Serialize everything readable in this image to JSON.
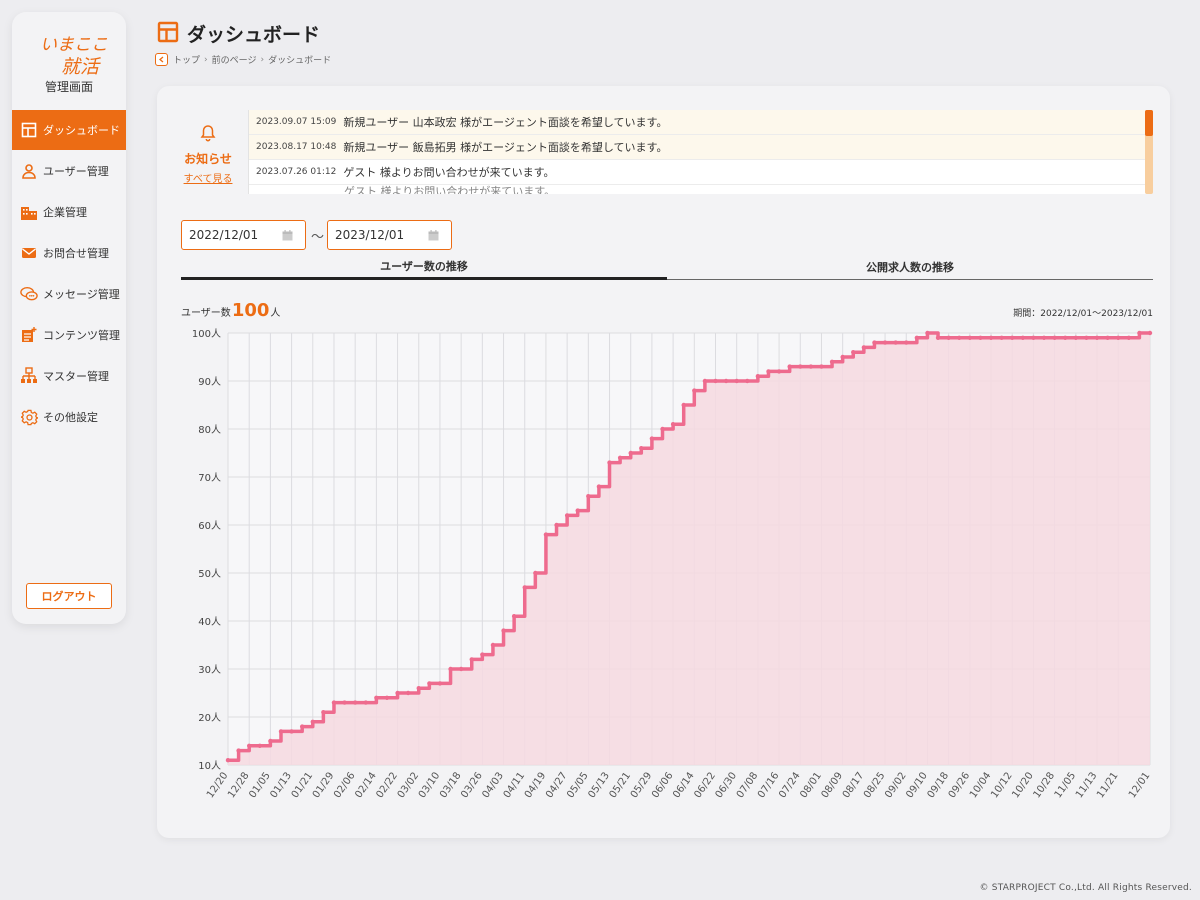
{
  "logo": {
    "line1": "いまここ",
    "line2": "就活"
  },
  "sidebar": {
    "subtitle": "管理画面",
    "items": [
      {
        "label": "ダッシュボード",
        "icon": "dashboard-icon"
      },
      {
        "label": "ユーザー管理",
        "icon": "user-icon"
      },
      {
        "label": "企業管理",
        "icon": "building-icon"
      },
      {
        "label": "お問合せ管理",
        "icon": "mail-icon"
      },
      {
        "label": "メッセージ管理",
        "icon": "chat-icon"
      },
      {
        "label": "コンテンツ管理",
        "icon": "content-edit-icon"
      },
      {
        "label": "マスター管理",
        "icon": "master-icon"
      },
      {
        "label": "その他設定",
        "icon": "gear-icon"
      }
    ],
    "logout": "ログアウト"
  },
  "header": {
    "title": "ダッシュボード",
    "breadcrumb": [
      "トップ",
      "前のページ",
      "ダッシュボード"
    ]
  },
  "notice": {
    "title": "お知らせ",
    "see_all": "すべて見る",
    "items": [
      {
        "date": "2023.09.07 15:09",
        "text": "新規ユーザー 山本政宏 様がエージェント面談を希望しています。"
      },
      {
        "date": "2023.08.17 10:48",
        "text": "新規ユーザー 飯島拓男 様がエージェント面談を希望しています。"
      },
      {
        "date": "2023.07.26 01:12",
        "text": "ゲスト 様よりお問い合わせが来ています。"
      },
      {
        "date": "",
        "text": "ゲスト 様よりお問い合わせが来ています。"
      }
    ]
  },
  "filter": {
    "start": "2022/12/01",
    "sep": "〜",
    "end": "2023/12/01"
  },
  "tabs": [
    "ユーザー数の推移",
    "公開求人数の推移"
  ],
  "stat": {
    "label": "ユーザー数",
    "value": "100",
    "unit": "人"
  },
  "period": "期間：2022/12/01〜2023/12/01",
  "footer": "© STARPROJECT Co.,Ltd. All Rights Reserved.",
  "colors": {
    "accent": "#ec6c14",
    "line": "#ee6b8e",
    "fill": "#f6d9e1"
  },
  "chart_data": {
    "type": "area",
    "x": [
      "12/20",
      "12/24",
      "12/28",
      "01/01",
      "01/05",
      "01/09",
      "01/13",
      "01/17",
      "01/21",
      "01/25",
      "01/29",
      "02/02",
      "02/06",
      "02/10",
      "02/14",
      "02/18",
      "02/22",
      "02/26",
      "03/02",
      "03/06",
      "03/10",
      "03/14",
      "03/18",
      "03/22",
      "03/26",
      "03/30",
      "04/03",
      "04/07",
      "04/11",
      "04/15",
      "04/19",
      "04/23",
      "04/27",
      "05/01",
      "05/05",
      "05/09",
      "05/13",
      "05/17",
      "05/21",
      "05/25",
      "05/29",
      "06/02",
      "06/06",
      "06/10",
      "06/14",
      "06/18",
      "06/22",
      "06/26",
      "06/30",
      "07/04",
      "07/08",
      "07/12",
      "07/16",
      "07/20",
      "07/24",
      "07/28",
      "08/01",
      "08/05",
      "08/09",
      "08/13",
      "08/17",
      "08/21",
      "08/25",
      "08/29",
      "09/02",
      "09/06",
      "09/10",
      "09/14",
      "09/18",
      "09/22",
      "09/26",
      "09/30",
      "10/04",
      "10/08",
      "10/12",
      "10/16",
      "10/20",
      "10/24",
      "10/28",
      "11/01",
      "11/05",
      "11/09",
      "11/13",
      "11/17",
      "11/21",
      "11/25",
      "11/29",
      "12/01"
    ],
    "series": [
      {
        "values": [
          11,
          13,
          14,
          14,
          15,
          17,
          17,
          18,
          19,
          21,
          23,
          23,
          23,
          23,
          24,
          24,
          25,
          25,
          26,
          27,
          27,
          30,
          30,
          32,
          33,
          35,
          38,
          41,
          47,
          50,
          58,
          60,
          62,
          63,
          66,
          68,
          73,
          74,
          75,
          76,
          78,
          80,
          81,
          85,
          88,
          90,
          90,
          90,
          90,
          90,
          91,
          92,
          92,
          93,
          93,
          93,
          93,
          94,
          95,
          96,
          97,
          98,
          98,
          98,
          98,
          99,
          100,
          99,
          99,
          99,
          99,
          99,
          99,
          99,
          99,
          99,
          99,
          99,
          99,
          99,
          99,
          99,
          99,
          99,
          99,
          99,
          100,
          100
        ]
      }
    ],
    "xticks": [
      "12/20",
      "12/28",
      "01/05",
      "01/13",
      "01/21",
      "01/29",
      "02/06",
      "02/14",
      "02/22",
      "03/02",
      "03/10",
      "03/18",
      "03/26",
      "04/03",
      "04/11",
      "04/19",
      "04/27",
      "05/05",
      "05/13",
      "05/21",
      "05/29",
      "06/06",
      "06/14",
      "06/22",
      "06/30",
      "07/08",
      "07/16",
      "07/24",
      "08/01",
      "08/09",
      "08/17",
      "08/25",
      "09/02",
      "09/10",
      "09/18",
      "09/26",
      "10/04",
      "10/12",
      "10/20",
      "10/28",
      "11/05",
      "11/13",
      "11/21",
      "12/01"
    ],
    "yticks": [
      "10人",
      "20人",
      "30人",
      "40人",
      "50人",
      "60人",
      "70人",
      "80人",
      "90人",
      "100人"
    ],
    "ylim": [
      10,
      100
    ],
    "grid": true
  }
}
